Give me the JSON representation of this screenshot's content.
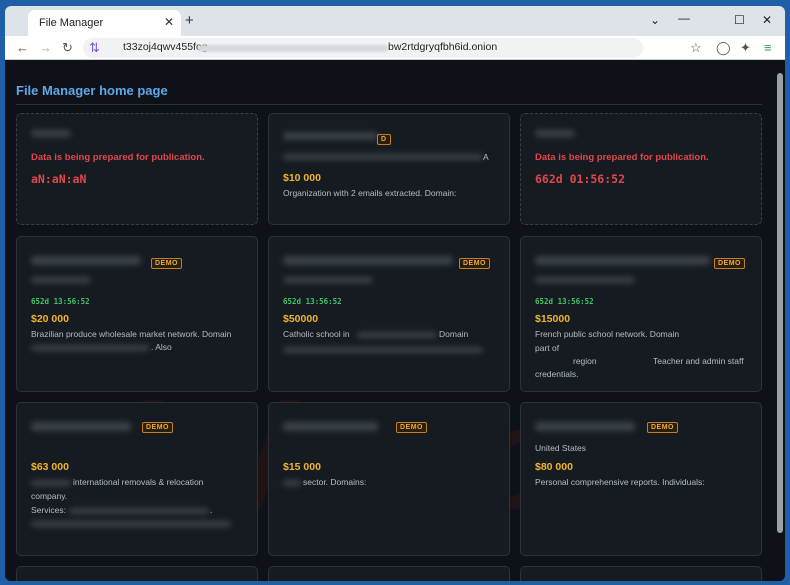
{
  "browser": {
    "tab_title": "File Manager",
    "tab_close": "✕",
    "new_tab": "+",
    "url_start": "t33zoj4qwv455fog",
    "url_end": "bw2rtdgryqfbh6id.onion",
    "icons": [
      "back-arrow-icon",
      "forward-arrow-icon",
      "reload-icon",
      "tor-circuit-icon",
      "star-icon",
      "shield-icon",
      "extensions-icon",
      "menu-icon"
    ],
    "window_controls": [
      "minimize",
      "maximize",
      "close"
    ]
  },
  "page": {
    "title": "File Manager home page",
    "watermark": "risk.com"
  },
  "cards": [
    {
      "publishing": "Data is being prepared for publication.",
      "timer": "aN:aN:aN"
    },
    {
      "badge": "D",
      "price": "$10 000",
      "desc": "Organization with 2 emails extracted. Domain:",
      "tail": "A"
    },
    {
      "publishing": "Data is being prepared for publication.",
      "timer": "662d 01:56:52"
    },
    {
      "badge": "DEMO",
      "timer": "652d 13:56:52",
      "price": "$20 000",
      "desc1": "Brazilian produce wholesale market network. Domain",
      "desc2": ". Also"
    },
    {
      "badge": "DEMO",
      "timer": "652d 13:56:52",
      "price": "$50000",
      "desc1": "Catholic school in",
      "desc1b": "Domain"
    },
    {
      "badge": "DEMO",
      "timer": "652d 13:56:52",
      "price": "$15000",
      "desc1": "French public school network. Domain",
      "desc2": "part of",
      "desc3a": "region",
      "desc3b": "Teacher and admin staff",
      "desc4": "credentials."
    },
    {
      "badge": "DEMO",
      "price": "$63 000",
      "desc1": "international removals & relocation",
      "desc2": "company.",
      "desc3": "Services:",
      "desc3b": "."
    },
    {
      "badge": "DEMO",
      "price": "$15 000",
      "desc1": "sector. Domains:"
    },
    {
      "badge": "DEMO",
      "country": "United States",
      "price": "$80 000",
      "desc1": "Personal comprehensive reports. Individuals:"
    }
  ]
}
